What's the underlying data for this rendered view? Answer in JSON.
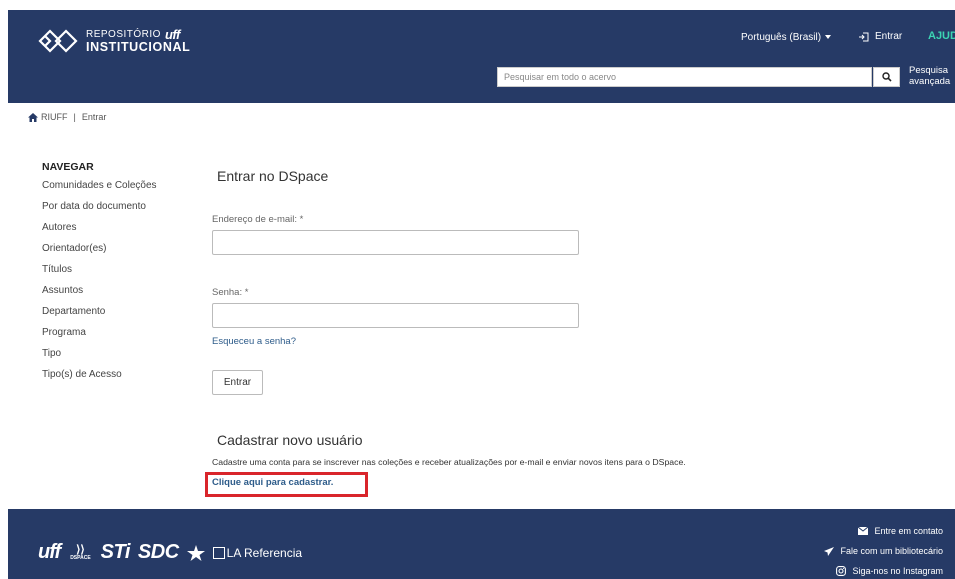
{
  "header": {
    "logo_line1": "REPOSITÓRIO",
    "logo_uff": "uff",
    "logo_line2": "INSTITUCIONAL",
    "language": "Português (Brasil)",
    "login": "Entrar",
    "help": "AJUDA",
    "search_placeholder": "Pesquisar em todo o acervo",
    "advanced_search": "Pesquisa avançada"
  },
  "breadcrumb": {
    "home": "RIUFF",
    "separator": "|",
    "current": "Entrar"
  },
  "sidebar": {
    "heading": "NAVEGAR",
    "items": [
      "Comunidades e Coleções",
      "Por data do documento",
      "Autores",
      "Orientador(es)",
      "Títulos",
      "Assuntos",
      "Departamento",
      "Programa",
      "Tipo",
      "Tipo(s) de Acesso"
    ]
  },
  "login_form": {
    "title": "Entrar no DSpace",
    "email_label": "Endereço de e-mail: *",
    "email_value": "",
    "password_label": "Senha: *",
    "password_value": "",
    "forgot_password": "Esqueceu a senha?",
    "submit": "Entrar"
  },
  "register": {
    "title": "Cadastrar novo usuário",
    "description": "Cadastre uma conta para se inscrever nas coleções e receber atualizações por e-mail e enviar novos itens para o DSpace.",
    "link": "Clique aqui para cadastrar.",
    "highlight_color": "#d9252b"
  },
  "footer": {
    "logos": {
      "uff": "uff",
      "dspace": "DSPACE",
      "sti": "STi",
      "sdc": "SDC",
      "la_referencia": "LA Referencia"
    },
    "links": [
      "Entre em contato",
      "Fale com um bibliotecário",
      "Siga-nos no Instagram"
    ]
  },
  "colors": {
    "header_bg": "#263a66",
    "help": "#3cd4b3",
    "link": "#2e5c8a"
  }
}
